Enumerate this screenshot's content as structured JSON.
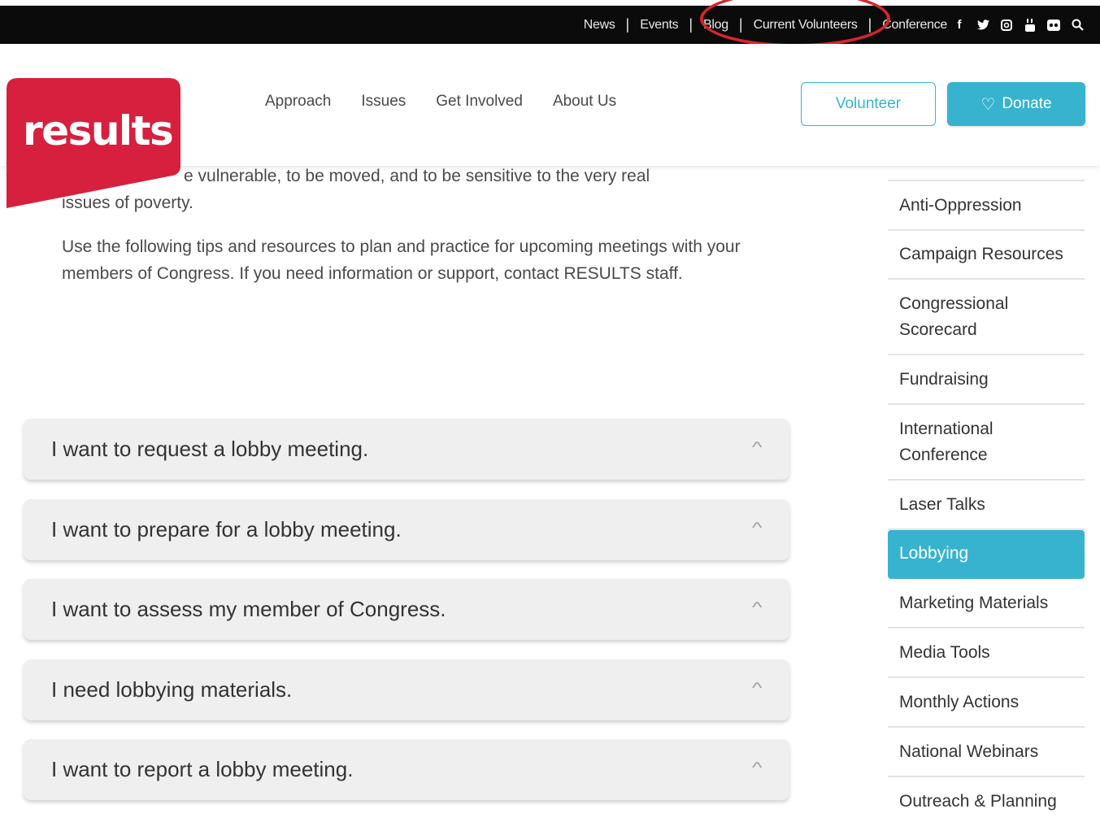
{
  "topbar": {
    "links": [
      "News",
      "Events",
      "Blog",
      "Current Volunteers",
      "Conference"
    ],
    "social_icons": [
      "facebook-icon",
      "twitter-icon",
      "instagram-icon",
      "youtube-icon",
      "flickr-icon",
      "search-icon"
    ]
  },
  "logo": {
    "text": "results"
  },
  "nav": {
    "items": [
      "Approach",
      "Issues",
      "Get Involved",
      "About Us"
    ],
    "volunteer_label": "Volunteer",
    "donate_label": "Donate"
  },
  "intro": {
    "para1_line1": "e vulnerable, to be moved, and to be sensitive to the very real",
    "para1_line2": "issues of poverty.",
    "para2": "Use the following tips and resources to plan and practice for upcoming meetings with your members of Congress. If you need information or support, contact RESULTS staff."
  },
  "accordion": [
    "I want to request a lobby meeting.",
    "I want to prepare for a lobby meeting.",
    "I want to assess my member of Congress.",
    "I need lobbying materials.",
    "I want to report a lobby meeting."
  ],
  "sidebar": {
    "items": [
      "Anti-Oppression",
      "Campaign Resources",
      "Congressional Scorecard",
      "Fundraising",
      "International Conference",
      "Laser Talks",
      "Lobbying",
      "Marketing Materials",
      "Media Tools",
      "Monthly Actions",
      "National Webinars",
      "Outreach & Planning"
    ],
    "active": "Lobbying"
  },
  "colors": {
    "brand_red": "#d6203e",
    "accent_teal": "#37b3cf",
    "annotation_red": "#d6252b"
  }
}
